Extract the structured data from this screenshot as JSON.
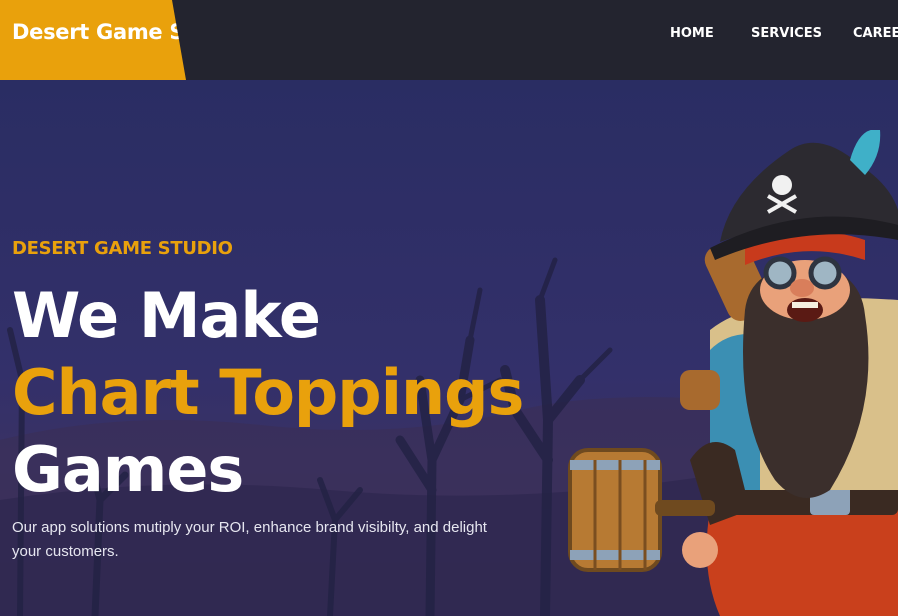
{
  "brand": {
    "name": "Desert Game Studio"
  },
  "nav": {
    "items": [
      {
        "label": "HOME"
      },
      {
        "label": "SERVICES"
      },
      {
        "label": "CAREER"
      }
    ]
  },
  "hero": {
    "eyebrow": "DESERT GAME STUDIO",
    "headline_line1": "We Make",
    "headline_line2": "Chart Toppings",
    "headline_line3": "Games",
    "subtitle": "Our app solutions mutiply your ROI, enhance brand visibilty, and delight your customers."
  },
  "colors": {
    "accent": "#e9a10c",
    "nav_bg": "#23242f",
    "hero_bg": "#2a2d5e",
    "text_light": "#ffffff"
  },
  "images": {
    "hero_character": "pirate-character-illustration",
    "background": "desert-dead-trees-night-scene"
  }
}
